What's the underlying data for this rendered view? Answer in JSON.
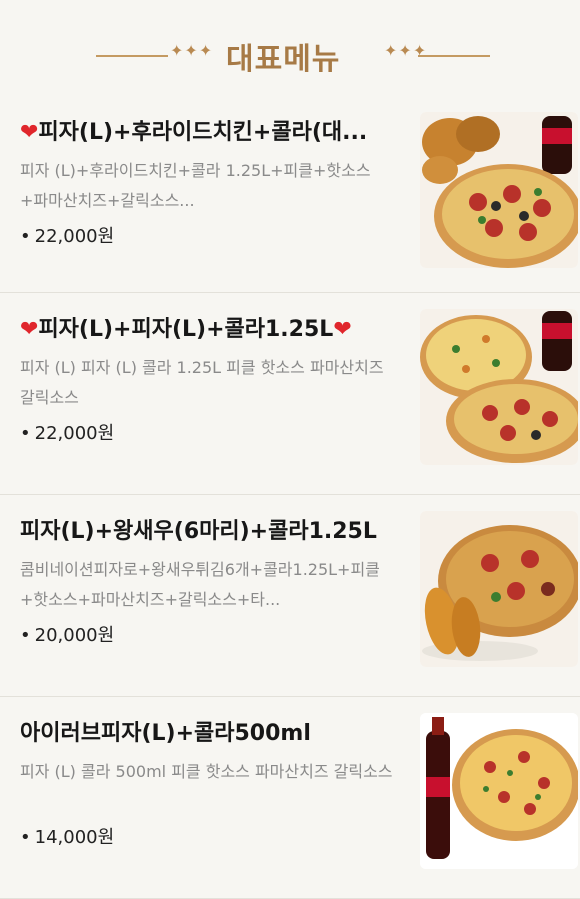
{
  "header": {
    "title": "대표메뉴",
    "deco": "✦✦✦"
  },
  "items": [
    {
      "title": "❤피자(L)+후라이드치킨+콜라(대...",
      "desc": "피자 (L)+후라이드치킨+콜라 1.25L+피클+핫소스+파마산치즈+갈릭소스...",
      "price": "22,000원",
      "image": "pizza-chicken-cola-photo"
    },
    {
      "title": "❤피자(L)+피자(L)+콜라1.25L❤",
      "desc": "피자 (L) 피자 (L) 콜라 1.25L 피클 핫소스 파마산치즈 갈릭소스",
      "price": "22,000원",
      "image": "two-pizzas-cola-photo"
    },
    {
      "title": "피자(L)+왕새우(6마리)+콜라1.25L",
      "desc": "콤비네이션피자로+왕새우튀김6개+콜라1.25L+피클+핫소스+파마산치즈+갈릭소스+타...",
      "price": "20,000원",
      "image": "pizza-fried-shrimp-photo"
    },
    {
      "title": "아이러브피자(L)+콜라500ml",
      "desc": "피자 (L) 콜라 500ml 피클 핫소스 파마산치즈 갈릭소스",
      "price": "14,000원",
      "image": "pizza-cola-bottle-photo"
    }
  ]
}
